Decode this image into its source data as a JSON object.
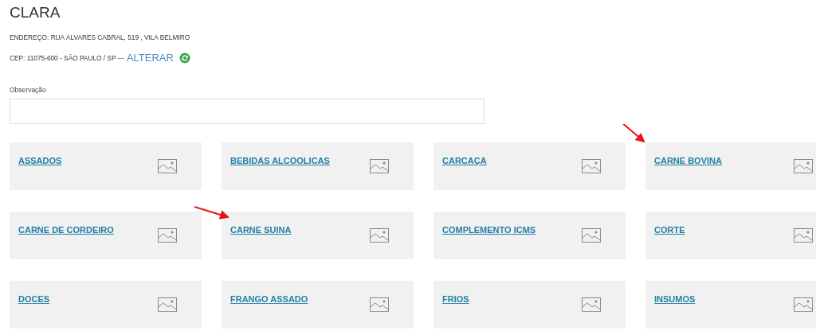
{
  "customer": {
    "name": "CLARA",
    "address": "ENDEREÇO: RUA ÁLVARES CABRAL, 519 , VILA BELMIRO",
    "cep": "CEP: 11075-600 - SÃO PAULO / SP ---",
    "change_link": "ALTERAR"
  },
  "observation": {
    "label": "Observação"
  },
  "categories": [
    {
      "label": "ASSADOS"
    },
    {
      "label": "BEBIDAS ALCOOLICAS"
    },
    {
      "label": "CARCAÇA"
    },
    {
      "label": "CARNE BOVINA",
      "arrow": true
    },
    {
      "label": "CARNE DE CORDEIRO"
    },
    {
      "label": "CARNE SUINA",
      "arrow": true
    },
    {
      "label": "COMPLEMENTO ICMS"
    },
    {
      "label": "CORTE"
    },
    {
      "label": "DOCES"
    },
    {
      "label": "FRANGO ASSADO"
    },
    {
      "label": "FRIOS"
    },
    {
      "label": "INSUMOS"
    }
  ]
}
